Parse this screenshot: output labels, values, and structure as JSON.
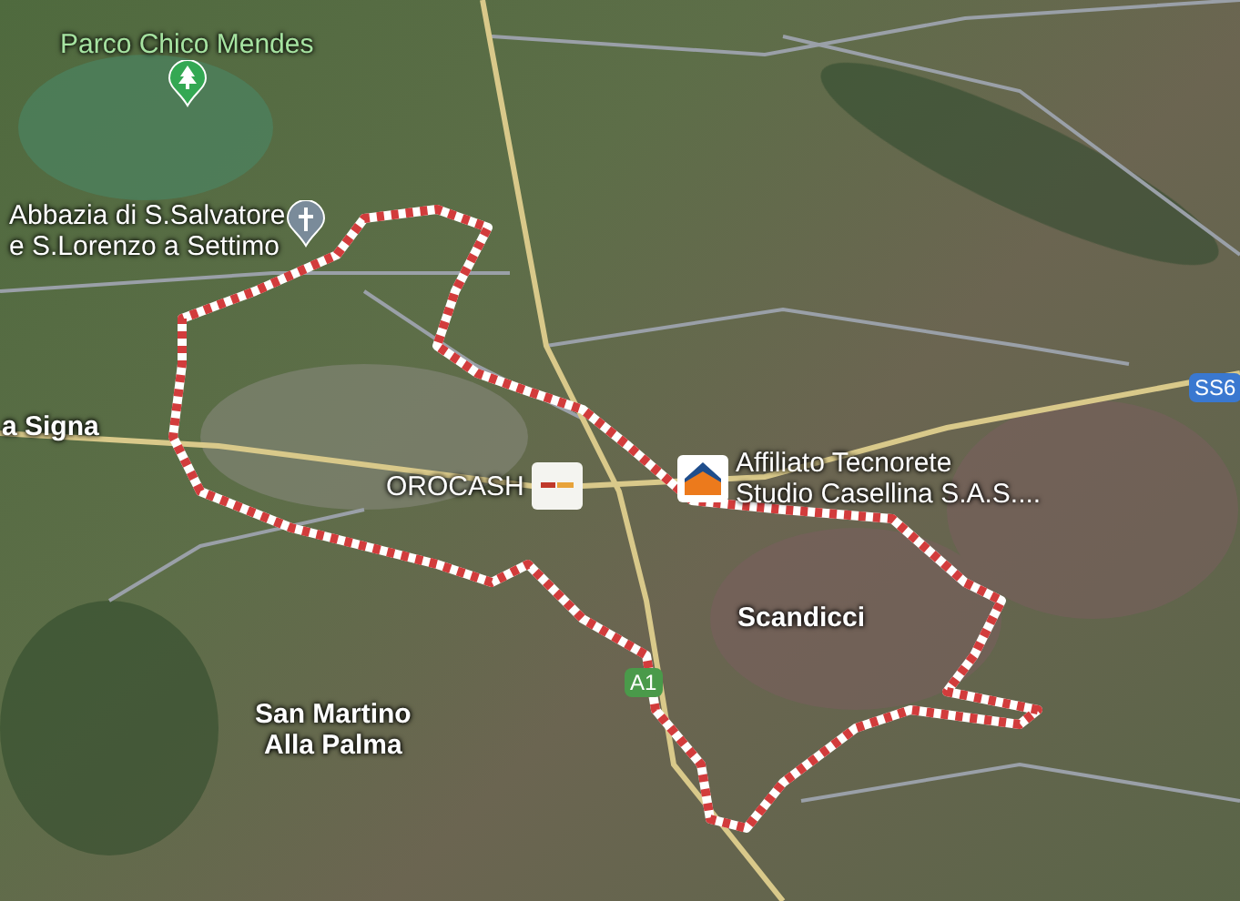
{
  "map": {
    "places": [
      {
        "kind": "park",
        "lines": [
          "Parco Chico Mendes"
        ]
      },
      {
        "kind": "church",
        "lines": [
          "Abbazia di S.Salvatore",
          "e S.Lorenzo a Settimo"
        ]
      },
      {
        "kind": "town",
        "lines": [
          "a Signa"
        ]
      },
      {
        "kind": "store",
        "lines": [
          "OROCASH"
        ]
      },
      {
        "kind": "agency",
        "lines": [
          "Affiliato Tecnorete",
          "Studio Casellina S.A.S...."
        ]
      },
      {
        "kind": "town",
        "lines": [
          "Scandicci"
        ]
      },
      {
        "kind": "town",
        "lines": [
          "San Martino",
          "Alla Palma"
        ]
      }
    ],
    "road_shields": [
      {
        "label": "A1",
        "color": "#4a9a4a"
      },
      {
        "label": "SS6",
        "color": "#3a78d0"
      }
    ]
  }
}
